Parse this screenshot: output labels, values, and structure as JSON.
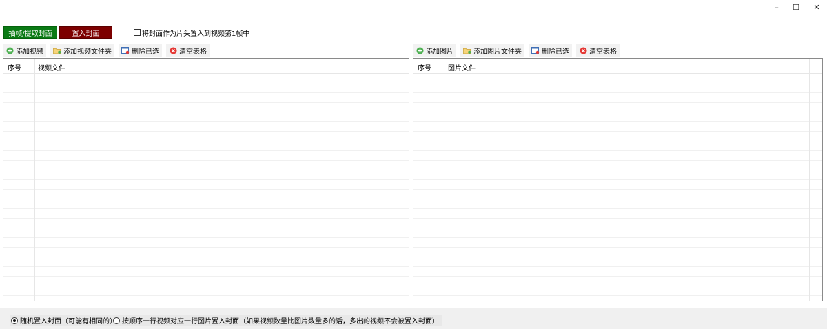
{
  "window": {
    "minimize": "–",
    "maximize": "☐",
    "close": "✕"
  },
  "top_actions": {
    "extract_label": "抽帧/提取封面",
    "insert_label": "置入封面",
    "first_frame_checkbox_label": "将封面作为片头置入到视频第1帧中",
    "first_frame_checked": false
  },
  "video_panel": {
    "toolbar": {
      "add_video": "添加视频",
      "add_folder": "添加视频文件夹",
      "delete_selected": "删除已选",
      "clear_table": "清空表格"
    },
    "columns": [
      "序号",
      "视频文件"
    ],
    "rows": []
  },
  "image_panel": {
    "toolbar": {
      "add_image": "添加图片",
      "add_folder": "添加图片文件夹",
      "delete_selected": "删除已选",
      "clear_table": "清空表格"
    },
    "columns": [
      "序号",
      "图片文件"
    ],
    "rows": []
  },
  "mode_options": {
    "random_label": "随机置入封面（可能有相同的）",
    "sequential_label": "按顺序一行视频对应一行图片置入封面（如果视频数量比图片数量多的话，多出的视频不会被置入封面）",
    "selected": "random"
  },
  "colors": {
    "extract_button": "#0a7a14",
    "insert_button": "#7d0000",
    "add_icon": "#4caf50",
    "clear_icon": "#e53935"
  }
}
